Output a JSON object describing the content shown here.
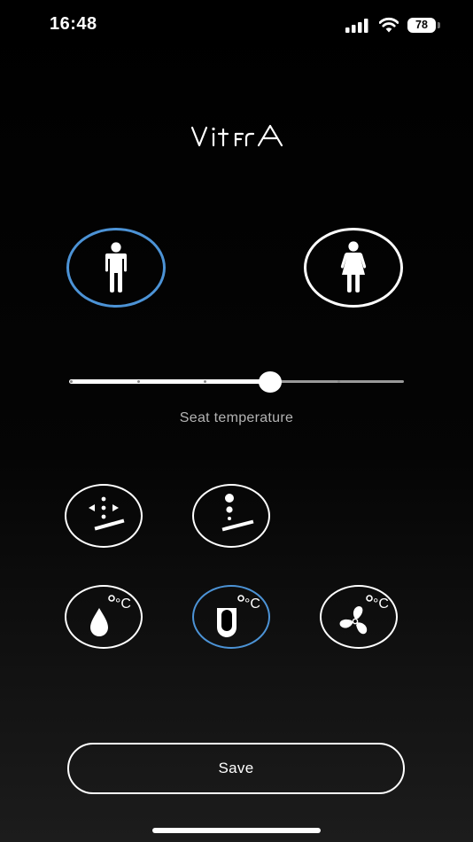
{
  "status_bar": {
    "time": "16:48",
    "battery_level": "78",
    "icons": [
      "signal-icon",
      "wifi-icon",
      "battery-icon"
    ]
  },
  "brand": {
    "logo_text": "VitrA"
  },
  "profiles": [
    {
      "id": "male",
      "icon": "male-figure-icon",
      "selected": true
    },
    {
      "id": "female",
      "icon": "female-figure-icon",
      "selected": false
    }
  ],
  "seat_temperature": {
    "label": "Seat temperature",
    "level_fraction": 0.6,
    "steps": 5
  },
  "modes": [
    {
      "id": "spray-oscillate",
      "icon": "spray-oscillate-icon",
      "selected": false
    },
    {
      "id": "spray-pulse",
      "icon": "spray-pulse-icon",
      "selected": false
    },
    {
      "id": "water-temperature",
      "icon": "water-temperature-icon",
      "unit": "°C",
      "selected": false
    },
    {
      "id": "seat-heat",
      "icon": "seat-heat-icon",
      "unit": "°C",
      "selected": true
    },
    {
      "id": "dryer-temperature",
      "icon": "dryer-fan-icon",
      "unit": "°C",
      "selected": false
    }
  ],
  "save": {
    "label": "Save"
  },
  "colors": {
    "background": "#000000",
    "accent_selected": "#4c93d6",
    "foreground": "#ffffff",
    "muted_text": "#b3b3b3",
    "slider_inactive": "#9a9a9a"
  }
}
